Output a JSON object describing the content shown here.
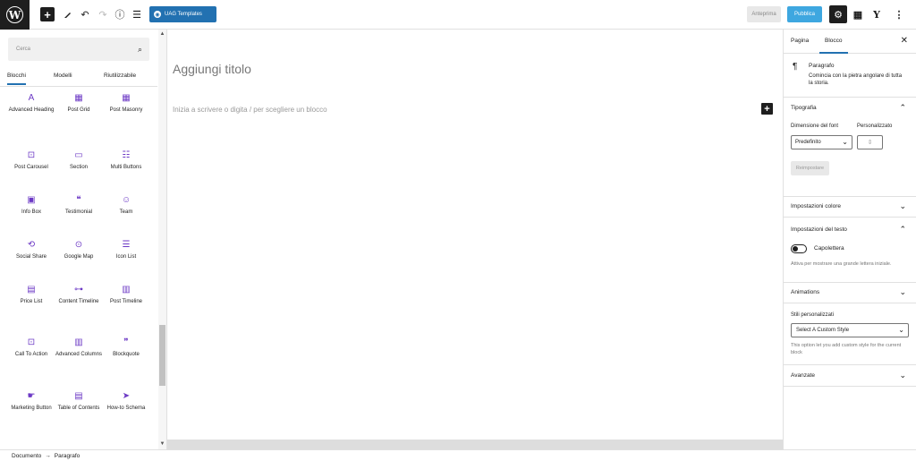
{
  "toolbar": {
    "logo_letter": "W",
    "uag_label": "UAG Templates",
    "preview_label": "Anteprima",
    "publish_label": "Pubblica"
  },
  "inserter": {
    "search_placeholder": "Cerca",
    "tabs": [
      "Blocchi",
      "Modelli",
      "Riutilizzabile"
    ],
    "blocks": [
      {
        "label": "Advanced Heading",
        "icon": "heading-icon"
      },
      {
        "label": "Post Grid",
        "icon": "grid-icon"
      },
      {
        "label": "Post Masonry",
        "icon": "masonry-icon"
      },
      {
        "label": "Post Carousel",
        "icon": "carousel-icon"
      },
      {
        "label": "Section",
        "icon": "section-icon"
      },
      {
        "label": "Multi Buttons",
        "icon": "buttons-icon"
      },
      {
        "label": "Info Box",
        "icon": "info-box-icon"
      },
      {
        "label": "Testimonial",
        "icon": "testimonial-icon"
      },
      {
        "label": "Team",
        "icon": "team-icon"
      },
      {
        "label": "Social Share",
        "icon": "share-icon"
      },
      {
        "label": "Google Map",
        "icon": "map-pin-icon"
      },
      {
        "label": "Icon List",
        "icon": "list-icon"
      },
      {
        "label": "Price List",
        "icon": "price-list-icon"
      },
      {
        "label": "Content Timeline",
        "icon": "timeline-icon"
      },
      {
        "label": "Post Timeline",
        "icon": "post-timeline-icon"
      },
      {
        "label": "Call To Action",
        "icon": "cta-icon"
      },
      {
        "label": "Advanced Columns",
        "icon": "columns-icon"
      },
      {
        "label": "Blockquote",
        "icon": "quote-icon"
      },
      {
        "label": "Marketing Button",
        "icon": "marketing-button-icon"
      },
      {
        "label": "Table of Contents",
        "icon": "toc-icon"
      },
      {
        "label": "How-to Schema",
        "icon": "howto-icon"
      }
    ]
  },
  "editor": {
    "title_placeholder": "Aggiungi titolo",
    "paragraph_placeholder": "Inizia a scrivere o digita / per scegliere un blocco"
  },
  "sidebar": {
    "tabs": [
      "Pagina",
      "Blocco"
    ],
    "block_name": "Paragrafo",
    "block_description": "Comincia con la pietra angolare di tutta la storia.",
    "typography": {
      "title": "Tipografia",
      "font_size_label": "Dimensione del font",
      "custom_label": "Personalizzato",
      "font_size_value": "Predefinito",
      "reset_label": "Reimpostare"
    },
    "color_title": "Impostazioni colore",
    "text_settings": {
      "title": "Impostazioni del testo",
      "dropcap_label": "Capolettera",
      "dropcap_help": "Attiva per mostrare una grande lettera iniziale."
    },
    "animations_title": "Animations",
    "custom_styles": {
      "label": "Stili personalizzati",
      "select_value": "Select A Custom Style",
      "help": "This option let you add custom style for the current block"
    },
    "advanced_title": "Avanzate"
  },
  "footer": {
    "crumb_root": "Documento",
    "separator": "→",
    "crumb_current": "Paragrafo"
  }
}
